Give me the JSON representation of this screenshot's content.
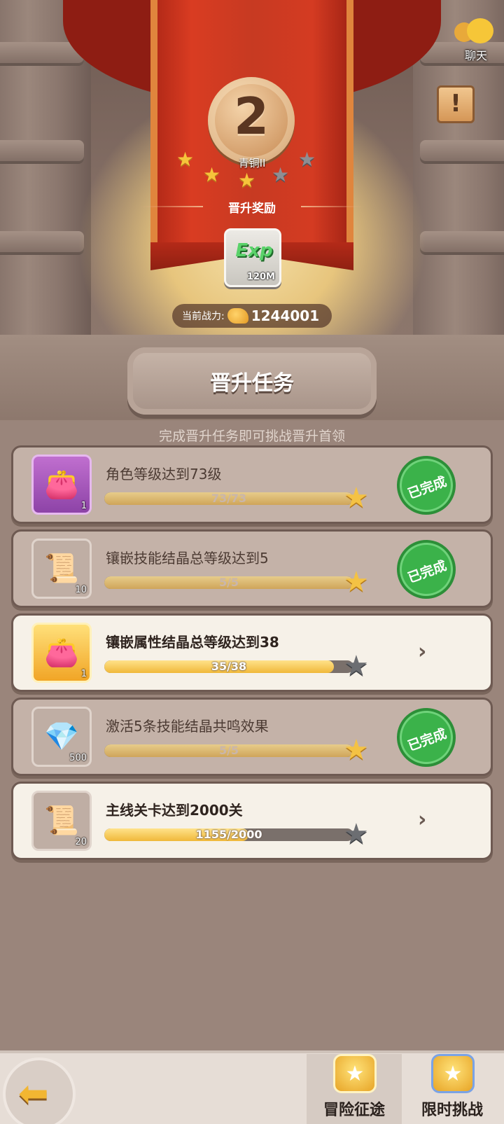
{
  "header": {
    "rank_number": "2",
    "rank_name": "青铜II",
    "stars": [
      true,
      true,
      true,
      false,
      false
    ],
    "promotion_reward_title": "晋升奖励",
    "reward": {
      "icon": "exp-icon",
      "label": "Exp",
      "count": "120M"
    },
    "power_label": "当前战力:",
    "power_value": "1244001",
    "chat_label": "聊天"
  },
  "section": {
    "title": "晋升任务",
    "subtitle": "完成晋升任务即可挑战晋升首领"
  },
  "tasks": [
    {
      "title": "角色等级达到73级",
      "progress_text": "73/73",
      "progress": 1.0,
      "icon": "bag-icon",
      "icon_count": "1",
      "completed": true,
      "completed_label": "已完成"
    },
    {
      "title": "镶嵌技能结晶总等级达到5",
      "progress_text": "5/5",
      "progress": 1.0,
      "icon": "scroll-icon",
      "icon_count": "10",
      "completed": true,
      "completed_label": "已完成"
    },
    {
      "title": "镶嵌属性结晶总等级达到38",
      "progress_text": "35/38",
      "progress": 0.921,
      "icon": "bag-icon",
      "icon_count": "1",
      "completed": false
    },
    {
      "title": "激活5条技能结晶共鸣效果",
      "progress_text": "5/5",
      "progress": 1.0,
      "icon": "crystal-icon",
      "icon_count": "500",
      "completed": true,
      "completed_label": "已完成"
    },
    {
      "title": "主线关卡达到2000关",
      "progress_text": "1155/2000",
      "progress": 0.578,
      "icon": "scroll-icon",
      "icon_count": "20",
      "completed": false
    }
  ],
  "bottom_nav": {
    "tab1_label": "冒险征途",
    "tab2_label": "限时挑战"
  }
}
